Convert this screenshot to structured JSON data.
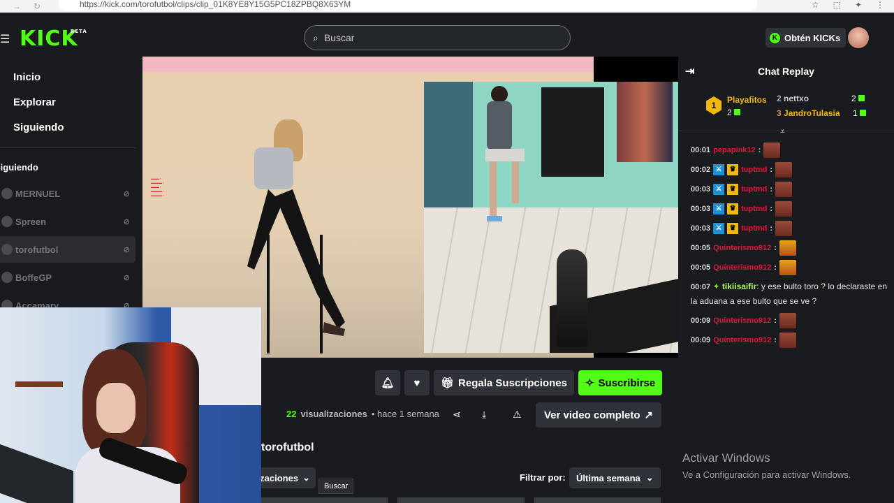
{
  "browser": {
    "url": "https://kick.com/torofutbol/clips/clip_01K8YE8Y15G5PC18ZPBQ8X63YM"
  },
  "header": {
    "logo": "KICK",
    "logo_badge": "BETA",
    "search_placeholder": "Buscar",
    "kicks_button": "Obtén KICKs"
  },
  "sidebar": {
    "nav": [
      "Inicio",
      "Explorar",
      "Siguiendo"
    ],
    "following_heading": "Siguiendo",
    "channels": [
      "MERNUEL",
      "Spreen",
      "torofutbol",
      "BoffeGP",
      "Accamary"
    ]
  },
  "actions": {
    "gift_label": "Regala Suscripciones",
    "subscribe_label": "Suscribirse"
  },
  "meta": {
    "views_count": "22",
    "views_label": "visualizaciones",
    "time": "• hace 1 semana",
    "full_video_label": "Ver video completo"
  },
  "clips_section": {
    "title": "torofutbol",
    "sort_label": "Visualizaciones",
    "tooltip": "Buscar",
    "filter_label": "Filtrar por:",
    "filter_value": "Última semana"
  },
  "chat": {
    "title": "Chat Replay",
    "leaderboard": {
      "first": {
        "rank": "1",
        "name": "Playafitos",
        "count": "2"
      },
      "second": {
        "rank": "2",
        "name": "nettxo",
        "count": "2"
      },
      "third": {
        "rank": "3",
        "name": "JandroTulasia",
        "count": "1"
      }
    },
    "messages": [
      {
        "time": "00:01",
        "user": "pepapink12"
      },
      {
        "time": "00:02",
        "user": "tuptmd"
      },
      {
        "time": "00:03",
        "user": "tuptmd"
      },
      {
        "time": "00:03",
        "user": "tuptmd"
      },
      {
        "time": "00:03",
        "user": "tuptmd"
      },
      {
        "time": "00:05",
        "user": "Quinterismo912"
      },
      {
        "time": "00:05",
        "user": "Quinterismo912"
      },
      {
        "time": "00:09",
        "user": "Quinterismo912"
      },
      {
        "time": "00:09",
        "user": "Quinterismo912"
      }
    ],
    "text_message": {
      "time": "00:07",
      "user": "tikiisaifir",
      "text": "y ese bulto toro ? lo declaraste en la aduana a ese bulto que se ve ?"
    }
  },
  "watermark": {
    "line1": "Activar Windows",
    "line2": "Ve a Configuración para activar Windows."
  },
  "colors": {
    "brand": "#53fc18",
    "background": "#191b1f",
    "username_red": "#e9113c"
  }
}
